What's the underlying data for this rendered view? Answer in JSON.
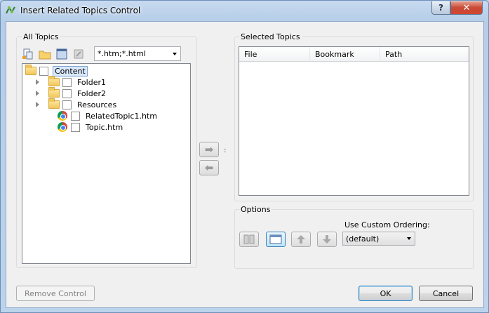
{
  "window": {
    "title": "Insert Related Topics Control",
    "help_label": "?",
    "close_label": "✕"
  },
  "all_topics": {
    "label": "All Topics",
    "toolbar_icons": [
      "copy-icon",
      "folder-icon",
      "window-icon",
      "disabled-icon"
    ],
    "filter_value": "*.htm;*.html",
    "tree": [
      {
        "label": "Content",
        "icon": "folder-open-icon",
        "expandable": false,
        "level": 0,
        "selected": true
      },
      {
        "label": "Folder1",
        "icon": "folder-icon",
        "expandable": true,
        "level": 1,
        "selected": false
      },
      {
        "label": "Folder2",
        "icon": "folder-icon",
        "expandable": true,
        "level": 1,
        "selected": false
      },
      {
        "label": "Resources",
        "icon": "folder-icon",
        "expandable": true,
        "level": 1,
        "selected": false
      },
      {
        "label": "RelatedTopic1.htm",
        "icon": "chrome-icon",
        "expandable": false,
        "level": 1,
        "selected": false
      },
      {
        "label": "Topic.htm",
        "icon": "chrome-icon",
        "expandable": false,
        "level": 1,
        "selected": false
      }
    ]
  },
  "selected_topics": {
    "label": "Selected Topics",
    "columns": [
      "File",
      "Bookmark",
      "Path"
    ]
  },
  "transfer": {
    "add_label": "➡",
    "remove_label": "⬅"
  },
  "options": {
    "label": "Options",
    "custom_ordering_label": "Use Custom Ordering:",
    "ordering_value": "(default)",
    "button_icons": [
      "book-icon",
      "window-icon",
      "arrow-up-icon",
      "arrow-down-icon"
    ]
  },
  "footer": {
    "remove_label": "Remove Control",
    "ok_label": "OK",
    "cancel_label": "Cancel"
  }
}
